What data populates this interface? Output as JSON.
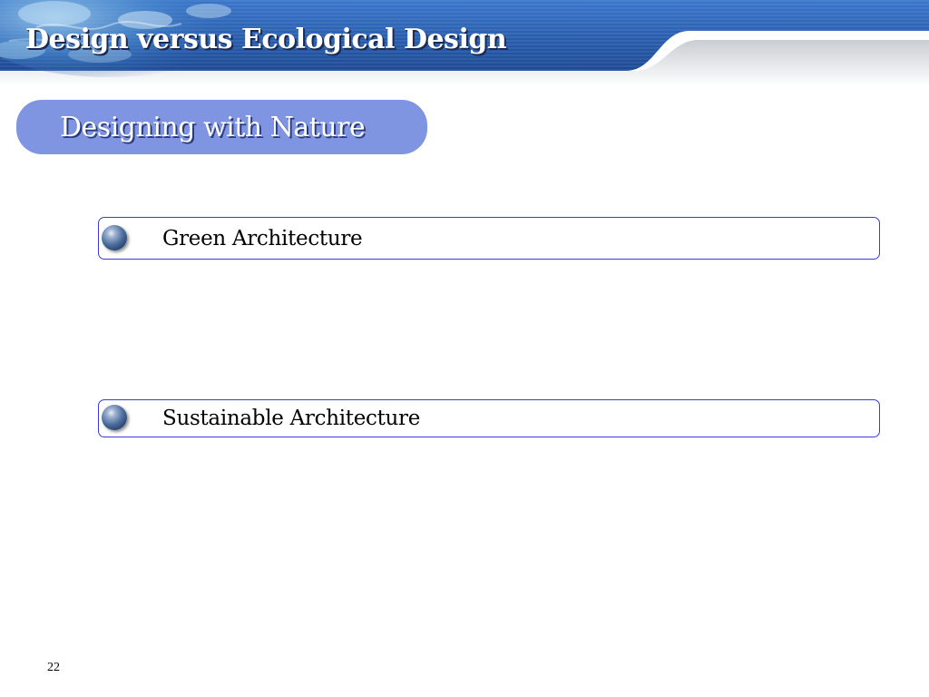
{
  "slide": {
    "title": "Design versus Ecological Design",
    "subtitle": "Designing with Nature",
    "bullets": [
      {
        "label": "Green Architecture"
      },
      {
        "label": "Sustainable Architecture"
      }
    ],
    "page_number": "22"
  },
  "colors": {
    "banner_blue": "#2d62b5",
    "pill_blue": "#7f95e2",
    "box_border": "#3b3bd6",
    "title_text": "#ffffff"
  },
  "icons": {
    "bullet": "blue-orb-icon",
    "banner_image": "water-texture-image"
  }
}
